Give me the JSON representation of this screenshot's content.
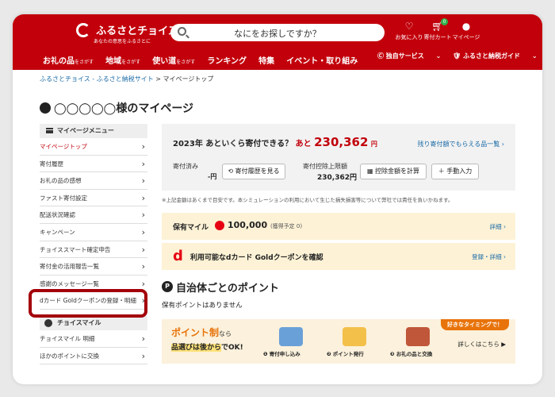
{
  "header": {
    "logo_name": "ふるさとチョイス",
    "logo_tagline": "あなたの意思をふるさとに",
    "search_placeholder": "なにをお探しですか？",
    "favorites_label": "お気に入り",
    "cart_label": "寄付カート",
    "cart_count": "0",
    "mypage_label": "マイページ",
    "nav": [
      {
        "label": "お礼の品",
        "suffix": "をさがす"
      },
      {
        "label": "地域",
        "suffix": "をさがす"
      },
      {
        "label": "使い道",
        "suffix": "をさがす"
      },
      {
        "label": "ランキング",
        "suffix": ""
      },
      {
        "label": "特集",
        "suffix": ""
      },
      {
        "label": "イベント・取り組み",
        "suffix": ""
      }
    ],
    "nav_right": [
      "独自サービス",
      "ふるさと納税ガイド"
    ]
  },
  "breadcrumb": [
    "ふるさとチョイス - ふるさと納税サイト",
    "マイページトップ"
  ],
  "page_title": "◯◯◯◯◯様のマイページ",
  "sidebar": {
    "menu_heading": "マイページメニュー",
    "items": [
      "マイページトップ",
      "寄付履歴",
      "お礼の品の感想",
      "ファスト寄付設定",
      "配送状況確認",
      "キャンペーン",
      "チョイススマート確定申告",
      "寄付金の活用報告一覧",
      "感謝のメッセージ一覧",
      "dカード Goldクーポンの登録・明細"
    ],
    "mile_heading": "チョイスマイル",
    "mile_items": [
      "チョイスマイル 明細",
      "ほかのポイントに交換"
    ]
  },
  "summary": {
    "year": "2023年",
    "question": "あといくら寄付できる？",
    "remaining_prefix": "あと",
    "remaining_amount": "230,362",
    "yen": "円",
    "remaining_link": "残り寄付額でもらえる品一覧",
    "donated_label": "寄付済み",
    "donated_value": "-円",
    "history_button": "寄付履歴を見る",
    "limit_label": "寄付控除上限額",
    "limit_value": "230,362円",
    "calc_button": "控除金額を計算",
    "manual_button": "手動入力"
  },
  "note": "※上記金額はあくまで目安です。本シミュレーションの利用において生じた損失損害等について弊社では責任を負いかねます。",
  "miles": {
    "label": "保有マイル",
    "value": "100,000",
    "pending": "(獲得予定 0)",
    "link": "詳細"
  },
  "dcard": {
    "text": "利用可能なdカード Goldクーポンを確認",
    "link": "登録・詳細"
  },
  "points_heading": "自治体ごとのポイント",
  "points_empty": "保有ポイントはありません",
  "banner": {
    "title": "ポイント制",
    "title_suffix": "なら",
    "subtitle_highlight": "品選びは後から",
    "subtitle_rest": "でOK!",
    "steps": [
      "寄付申し込み",
      "ポイント発行",
      "お礼の品と交換"
    ],
    "timing": "好きなタイミングで！",
    "detail": "詳しくはこちら"
  },
  "colors": {
    "brand": "#c2000b",
    "link": "#1a6aa6",
    "accent": "#e8730a"
  }
}
